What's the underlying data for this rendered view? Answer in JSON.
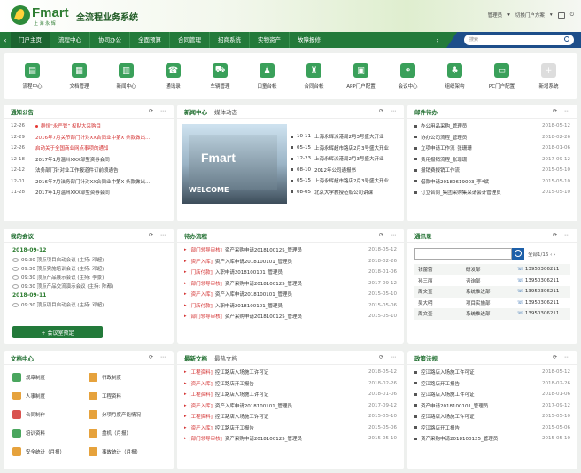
{
  "header": {
    "brand": "Fmart",
    "brand_sub": "上 海 永 辉",
    "system_title": "全流程业务系统",
    "admin": "管理员",
    "switch_portal": "切换门户方案"
  },
  "nav": {
    "items": [
      "门户主页",
      "流程中心",
      "协同办公",
      "全面预算",
      "合同管理",
      "招商系统",
      "实物资产",
      "故障报修"
    ],
    "active": 0,
    "search_placeholder": "搜索"
  },
  "apps": [
    {
      "label": "流程中心",
      "icon": "flow-icon",
      "glyph": "▤"
    },
    {
      "label": "文档管理",
      "icon": "document-icon",
      "glyph": "▦"
    },
    {
      "label": "新闻中心",
      "icon": "news-icon",
      "glyph": "▥"
    },
    {
      "label": "通讯录",
      "icon": "contacts-icon",
      "glyph": "☎"
    },
    {
      "label": "车辆管理",
      "icon": "car-icon",
      "glyph": "⛟"
    },
    {
      "label": "口童台帐",
      "icon": "user-icon",
      "glyph": "♟"
    },
    {
      "label": "合同台帐",
      "icon": "contract-icon",
      "glyph": "♜"
    },
    {
      "label": "APP门户配置",
      "icon": "app-config-icon",
      "glyph": "▣"
    },
    {
      "label": "会议中心",
      "icon": "meeting-icon",
      "glyph": "⚭"
    },
    {
      "label": "组织架构",
      "icon": "org-icon",
      "glyph": "♣"
    },
    {
      "label": "PC门户配置",
      "icon": "pc-config-icon",
      "glyph": "▭"
    },
    {
      "label": "新增系统",
      "icon": "add-icon",
      "glyph": "+"
    }
  ],
  "notice": {
    "title": "通知公告",
    "items": [
      {
        "date": "12-26",
        "text": "群恒“永严管”  权贴大采购目",
        "red": true,
        "dot": true
      },
      {
        "date": "12-29",
        "text": "2016年7月关节部门针对XX合同业中第X 条款做出…",
        "red": true,
        "dot": false
      },
      {
        "date": "12-26",
        "text": "启动关于全国商业网点事项的通知",
        "red": true,
        "dot": false
      },
      {
        "date": "12-18",
        "text": "2017年1月温州XXX部型资券会同",
        "red": false,
        "dot": false
      },
      {
        "date": "12-12",
        "text": "法务部门针对业工作报道件订前须通告",
        "red": false,
        "dot": false
      },
      {
        "date": "12-01",
        "text": "2016年7月法务部门针对XX合同业中第X 条款做出…",
        "red": false,
        "dot": false
      },
      {
        "date": "11-28",
        "text": "2017年1月温州XXX部型资券会同",
        "red": false,
        "dot": false
      }
    ]
  },
  "news": {
    "tab1": "新闻中心",
    "tab2": "媒体动态",
    "photo_brand": "Fmart",
    "photo_welcome": "WELCOME",
    "items": [
      {
        "date": "10-11",
        "text": "上海永辉派港局2月3号盛大开业"
      },
      {
        "date": "05-15",
        "text": "上海永辉超市路店2月3号盛大开业"
      },
      {
        "date": "12-23",
        "text": "上海永辉派港局2月3号盛大开业"
      },
      {
        "date": "08-10",
        "text": "2012年公司通报书"
      },
      {
        "date": "05-15",
        "text": "上海永辉超市路店2月3号盛大开业"
      },
      {
        "date": "08-05",
        "text": "北京大学教授莅临公司讲课"
      }
    ]
  },
  "mail": {
    "title": "邮件待办",
    "items": [
      {
        "text": "办公用品采购_管理员",
        "date": "2018-05-12"
      },
      {
        "text": "协办公司流程_管理员",
        "date": "2018-02-26"
      },
      {
        "text": "立项申请工作流_张珊珊",
        "date": "2018-01-06"
      },
      {
        "text": "费用报销流程_张珊珊",
        "date": "2017-09-12"
      },
      {
        "text": "报销费报销工作流",
        "date": "2015-05-10"
      },
      {
        "text": "借款申请20180619003_李*斌",
        "date": "2015-05-10"
      },
      {
        "text": "订立合同_集团采购集采请会计管理员",
        "date": "2015-05-10"
      }
    ]
  },
  "meeting": {
    "title": "我的会议",
    "groups": [
      {
        "date": "2018-09-12",
        "items": [
          "09:30 顶点项目启动会议 (主持: 邓超)",
          "09:30 顶点实施培训会议 (主持: 邓超)",
          "09:30 顶点产品展示会议 (主持: 李景)",
          "09:30 顶点产品交流演示会议 (主持: 陈都)"
        ]
      },
      {
        "date": "2018-09-11",
        "items": [
          "09:30 顶点项目启动会议 (主持: 邓超)"
        ]
      }
    ],
    "button": "+ 会议室预定"
  },
  "pending": {
    "title": "待办流程",
    "items": [
      {
        "tag": "[部门领导审核]",
        "text": "资产采购申请2018100125_管理员",
        "date": "2018-05-12"
      },
      {
        "tag": "[资产入库]",
        "text": "资产入库申请2018100101_管理员",
        "date": "2018-02-26"
      },
      {
        "tag": "[门店付款]",
        "text": "入职申请2018100101_管理员",
        "date": "2018-01-06"
      },
      {
        "tag": "[部门领导审核]",
        "text": "资产采购申请2018100125_管理员",
        "date": "2017-09-12"
      },
      {
        "tag": "[资产入库]",
        "text": "资产入库申请2018100101_管理员",
        "date": "2015-05-10"
      },
      {
        "tag": "[门店付款]",
        "text": "入职申请2018100101_管理员",
        "date": "2015-05-06"
      },
      {
        "tag": "[部门领导审核]",
        "text": "资产采购申请2018100125_管理员",
        "date": "2015-05-10"
      }
    ]
  },
  "contacts": {
    "title": "通讯录",
    "pager": "全部1/16",
    "rows": [
      {
        "name": "钱蕾蕾",
        "dept": "研发部",
        "phone": "13950306211"
      },
      {
        "name": "孙三丽",
        "dept": "咨询部",
        "phone": "13950306211"
      },
      {
        "name": "周文奎",
        "dept": "系统推进部",
        "phone": "13950306211"
      },
      {
        "name": "吴大明",
        "dept": "项目实施部",
        "phone": "13950306211"
      },
      {
        "name": "周文奎",
        "dept": "系统推进部",
        "phone": "13950306211"
      }
    ]
  },
  "docs": {
    "title": "文档中心",
    "items": [
      {
        "label": "规章制度",
        "icon": "rules-icon",
        "color": "#4aa65e"
      },
      {
        "label": "行政制度",
        "icon": "admin-icon",
        "color": "#e6a23c"
      },
      {
        "label": "人事制度",
        "icon": "hr-icon",
        "color": "#e6a23c"
      },
      {
        "label": "工程资料",
        "icon": "engineering-icon",
        "color": "#e6a23c"
      },
      {
        "label": "合同制作",
        "icon": "contract-doc-icon",
        "color": "#d9534f"
      },
      {
        "label": "分项月度产能情况",
        "icon": "capacity-icon",
        "color": "#e6a23c"
      },
      {
        "label": "培训资料",
        "icon": "training-icon",
        "color": "#4aa65e"
      },
      {
        "label": "盘机（月报）",
        "icon": "report-icon",
        "color": "#e6a23c"
      },
      {
        "label": "安全统计（月报）",
        "icon": "safety-icon",
        "color": "#e6a23c"
      },
      {
        "label": "事故统计（月报）",
        "icon": "accident-icon",
        "color": "#e6a23c"
      }
    ]
  },
  "newdocs": {
    "tab1": "最新文档",
    "tab2": "最热文档",
    "items": [
      {
        "tag": "[工程资料]",
        "text": "控江路店入场施工许可证",
        "date": "2018-05-12"
      },
      {
        "tag": "[资产入库]",
        "text": "控江路店开工报告",
        "date": "2018-02-26"
      },
      {
        "tag": "[工程资料]",
        "text": "控江路店入场施工许可证",
        "date": "2018-01-06"
      },
      {
        "tag": "[资产入库]",
        "text": "资产入库申请2018100101_管理员",
        "date": "2017-09-12"
      },
      {
        "tag": "[工程资料]",
        "text": "控江路店入场施工许可证",
        "date": "2015-05-10"
      },
      {
        "tag": "[资产入库]",
        "text": "控江路店开工报告",
        "date": "2015-05-06"
      },
      {
        "tag": "[部门领导审核]",
        "text": "资产采购申请2018100125_管理员",
        "date": "2015-05-10"
      }
    ]
  },
  "policy": {
    "title": "政策法规",
    "items": [
      {
        "text": "控江路店入场施工许可证",
        "date": "2018-05-12"
      },
      {
        "text": "控江路店开工报告",
        "date": "2018-02-26"
      },
      {
        "text": "控江路店入场施工许可证",
        "date": "2018-01-06"
      },
      {
        "text": "资产申请2018100101_管理员",
        "date": "2017-09-12"
      },
      {
        "text": "控江路店入场施工许可证",
        "date": "2015-05-10"
      },
      {
        "text": "控江路店开工报告",
        "date": "2015-05-06"
      },
      {
        "text": "资产采购申请2018100125_管理员",
        "date": "2015-05-10"
      }
    ]
  }
}
